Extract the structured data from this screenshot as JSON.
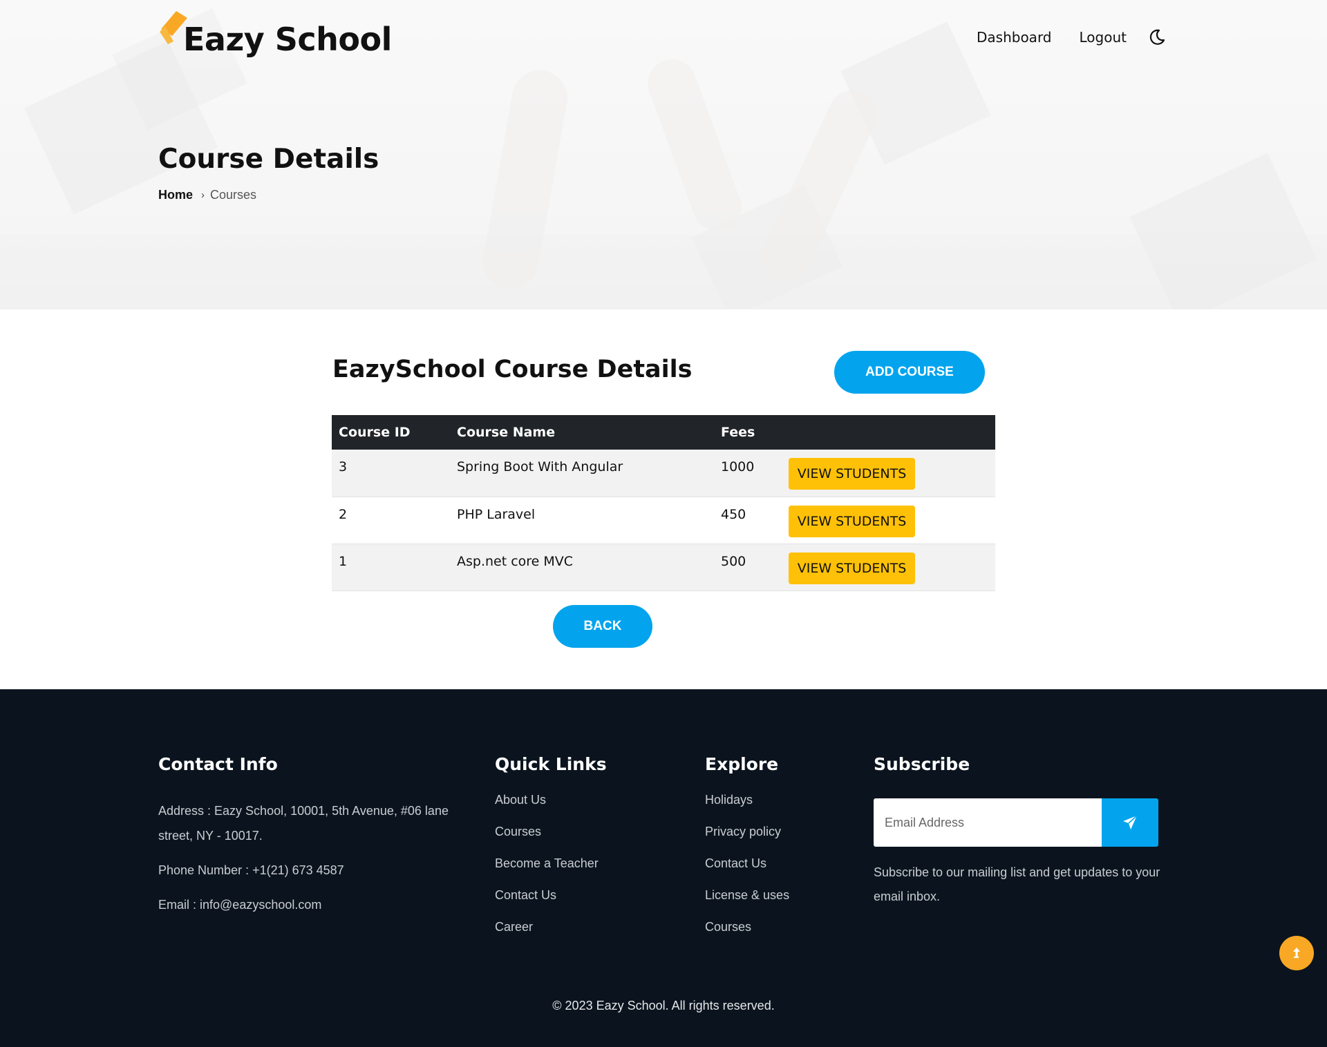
{
  "brand": {
    "name": "Eazy School"
  },
  "nav": {
    "dashboard": "Dashboard",
    "logout": "Logout"
  },
  "hero": {
    "title": "Course Details",
    "breadcrumb": {
      "home": "Home",
      "current": "Courses"
    }
  },
  "main": {
    "title": "EazySchool Course Details",
    "add_course_label": "ADD COURSE",
    "back_label": "BACK",
    "table": {
      "headers": [
        "Course ID",
        "Course Name",
        "Fees",
        ""
      ],
      "rows": [
        {
          "id": "3",
          "name": "Spring Boot With Angular",
          "fees": "1000",
          "action": "VIEW STUDENTS"
        },
        {
          "id": "2",
          "name": "PHP Laravel",
          "fees": "450",
          "action": "VIEW STUDENTS"
        },
        {
          "id": "1",
          "name": "Asp.net core MVC",
          "fees": "500",
          "action": "VIEW STUDENTS"
        }
      ]
    }
  },
  "footer": {
    "contact": {
      "title": "Contact Info",
      "address": "Address : Eazy School, 10001, 5th Avenue, #06 lane street, NY - 10017.",
      "phone": "Phone Number : +1(21) 673 4587",
      "email": "Email : info@eazyschool.com"
    },
    "quick_links": {
      "title": "Quick Links",
      "items": [
        "About Us",
        "Courses",
        "Become a Teacher",
        "Contact Us",
        "Career"
      ]
    },
    "explore": {
      "title": "Explore",
      "items": [
        "Holidays",
        "Privacy policy",
        "Contact Us",
        "License & uses",
        "Courses"
      ]
    },
    "subscribe": {
      "title": "Subscribe",
      "placeholder": "Email Address",
      "text": "Subscribe to our mailing list and get updates to your email inbox."
    },
    "copyright": "© 2023 Eazy School. All rights reserved."
  },
  "colors": {
    "primary": "#03a4ed",
    "accent_yellow": "#ffc107",
    "logo_orange": "#f9a825",
    "footer_bg": "#0b141e",
    "table_header_bg": "#212529"
  },
  "icons": [
    "graduation-cap-icon",
    "moon-icon",
    "chevron-right-icon",
    "send-icon",
    "arrow-up-icon"
  ]
}
